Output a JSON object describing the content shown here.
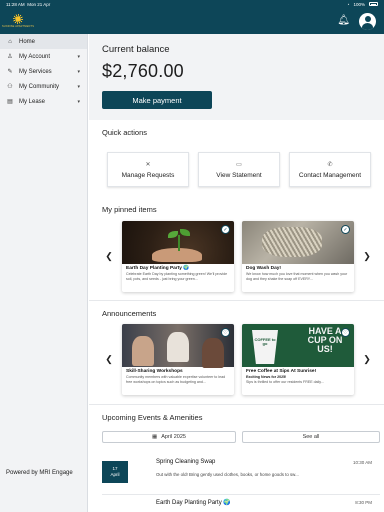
{
  "status_bar": {
    "time": "11:28 AM",
    "date": "Mon 21 Apr",
    "wifi": "wifi-icon",
    "battery": "100%"
  },
  "header": {
    "logo_text": "SUNRISE APARTMENTS",
    "bell_icon": "bell-icon",
    "avatar_icon": "user-avatar-icon"
  },
  "sidebar": {
    "items": [
      {
        "label": "Home",
        "icon": "home-icon"
      },
      {
        "label": "My Account",
        "icon": "person-icon"
      },
      {
        "label": "My Services",
        "icon": "wrench-icon"
      },
      {
        "label": "My Community",
        "icon": "community-icon"
      },
      {
        "label": "My Lease",
        "icon": "document-icon"
      }
    ],
    "powered_by": "Powered by MRI Engage"
  },
  "balance": {
    "label": "Current balance",
    "amount": "$2,760.00",
    "pay_button": "Make payment"
  },
  "quick_actions": {
    "title": "Quick actions",
    "items": [
      {
        "label": "Manage Requests",
        "icon": "tools-icon"
      },
      {
        "label": "View Statement",
        "icon": "statement-icon"
      },
      {
        "label": "Contact Management",
        "icon": "phone-icon"
      }
    ]
  },
  "pinned": {
    "title": "My pinned items",
    "items": [
      {
        "title": "Earth Day Planting Party 🌍",
        "desc": "Celebrate Earth Day by planting something green! We'll provide soil, pots, and seeds - just bring your green..."
      },
      {
        "title": "Dog Wash Day!",
        "desc": "We know how much you love that moment when you wash your dog and they shake the soap off EVERY..."
      }
    ]
  },
  "announcements": {
    "title": "Announcements",
    "items": [
      {
        "title": "Skill-Sharing Workshops",
        "desc": "Community members with valuable expertise volunteer to lead free workshops on topics such as budgeting and..."
      },
      {
        "title": "Free Coffee at Sips At Sunrise!",
        "subtitle": "Exciting News for 2025!",
        "desc": "Sips is thrilled to offer our residents FREE daily...",
        "image_text_cup": "COFFEE to go",
        "image_text_sign": "HAVE A CUP ON US!"
      }
    ]
  },
  "events": {
    "title": "Upcoming Events & Amenities",
    "month_button": "April 2025",
    "see_all": "See all",
    "items": [
      {
        "day": "17",
        "month": "April",
        "name": "Spring Cleaning Swap",
        "desc": "Out with the old! Bring gently used clothes, books, or home goods to sw...",
        "time": "10:30 AM"
      },
      {
        "day": "",
        "month": "",
        "name": "Earth Day Planting Party 🌍",
        "desc": "",
        "time": "8:30 PM"
      }
    ]
  },
  "colors": {
    "brand": "#0d4658",
    "accent": "#f6c229",
    "panel": "#f2f3f5"
  }
}
